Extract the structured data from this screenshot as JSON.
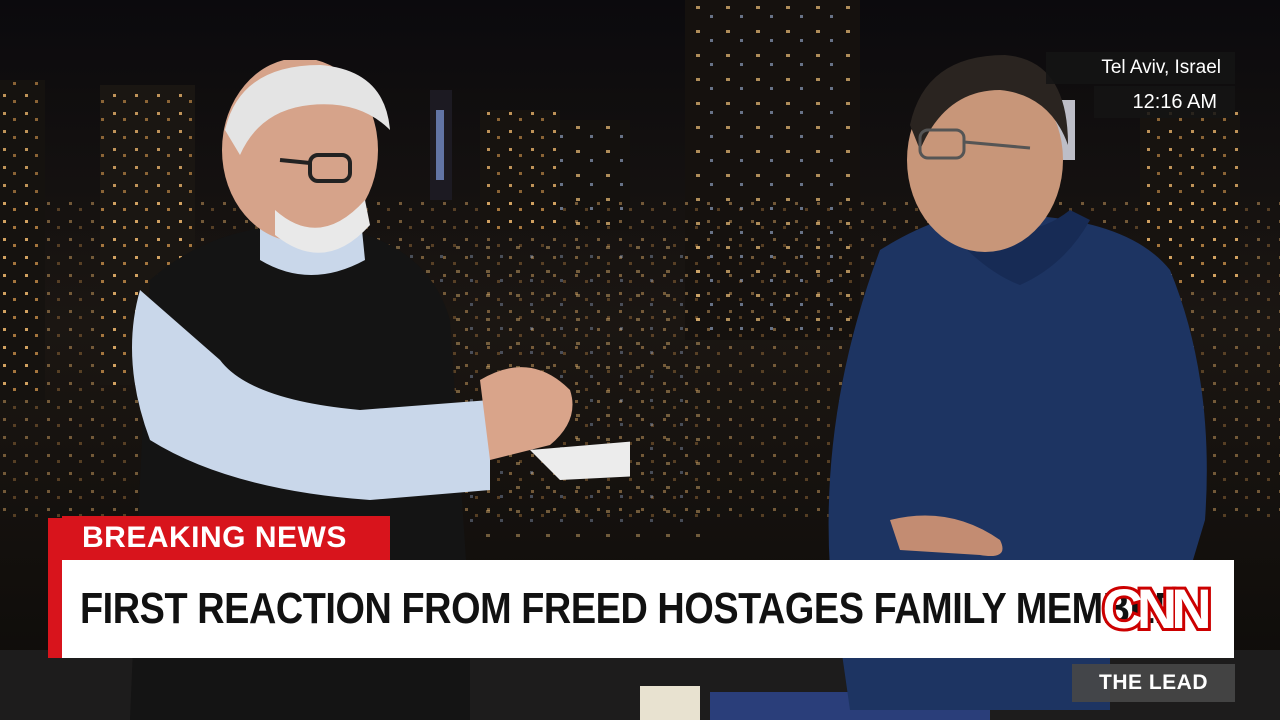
{
  "location": "Tel Aviv, Israel",
  "time": "12:16 AM",
  "lower_third": {
    "banner": "BREAKING NEWS",
    "headline": "FIRST REACTION FROM FREED HOSTAGES FAMILY MEMBER",
    "logo_text": "CNN",
    "show_name": "THE LEAD"
  },
  "colors": {
    "breaking_red": "#d8141c",
    "logo_red": "#cc0000",
    "headline_bg": "#ffffff"
  }
}
